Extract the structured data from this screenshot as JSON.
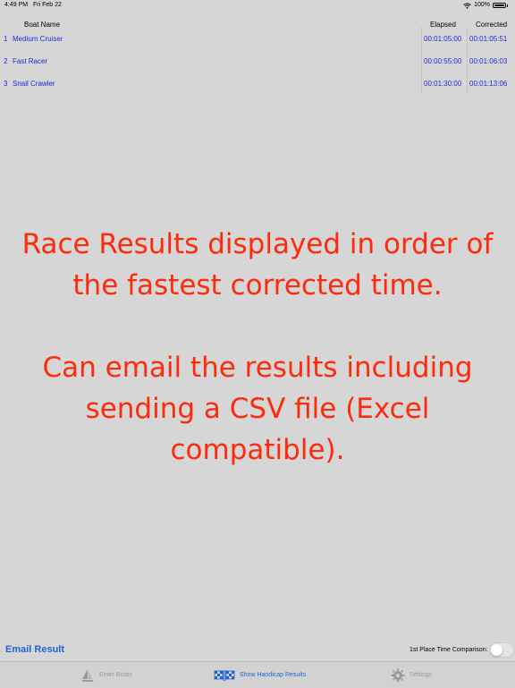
{
  "status_bar": {
    "time": "4:49 PM",
    "date": "Fri Feb 22",
    "battery": "100%"
  },
  "table": {
    "headers": {
      "name": "Boat Name",
      "elapsed": "Elapsed",
      "corrected": "Corrected"
    },
    "rows": [
      {
        "num": "1",
        "name": "Medium Cruiser",
        "elapsed": "00:01:05:00",
        "corrected": "00:01:05:51"
      },
      {
        "num": "2",
        "name": "Fast Racer",
        "elapsed": "00:00:55:00",
        "corrected": "00:01:06:03"
      },
      {
        "num": "3",
        "name": "Snail Crawler",
        "elapsed": "00:01:30:00",
        "corrected": "00:01:13:06"
      }
    ]
  },
  "promo": {
    "line1": "Race Results displayed in order of",
    "line2": "the fastest corrected time.",
    "line3": "Can email the results including",
    "line4": "sending a CSV file (Excel",
    "line5": "compatible)."
  },
  "footer": {
    "email_label": "Email Result",
    "toggle_label": "1st Place Time Comparison:",
    "toggle_on": false
  },
  "tabs": {
    "enter_boats": "Enter Boats",
    "show_results": "Show Handicap Results",
    "settings": "Settings"
  },
  "colors": {
    "link_blue": "#1d2bd9",
    "accent_blue": "#1f63d8",
    "promo_red": "#ff2a0a",
    "background": "#d6d6d6"
  },
  "icons": {
    "wifi": "wifi-icon",
    "battery": "battery-icon",
    "enter_boats": "sailboat-icon",
    "show_results": "checkered-flags-icon",
    "settings": "gear-icon"
  }
}
